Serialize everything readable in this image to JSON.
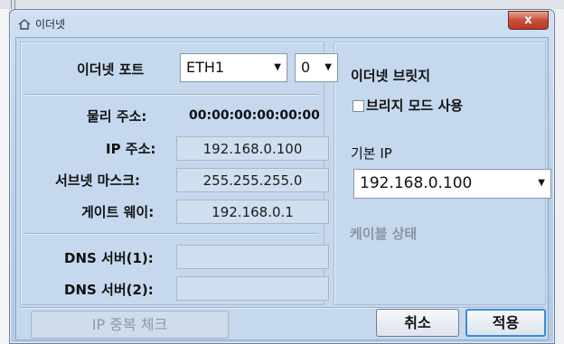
{
  "window": {
    "title": "이더넷",
    "close_label": "x"
  },
  "ethernet_port": {
    "label": "이더넷 포트",
    "port_value": "ETH1",
    "index_value": "0"
  },
  "physical_address": {
    "label": "물리 주소:",
    "value": "00:00:00:00:00:00"
  },
  "ip_address": {
    "label": "IP 주소:",
    "value": "192.168.0.100"
  },
  "subnet_mask": {
    "label": "서브넷 마스크:",
    "value": "255.255.255.0"
  },
  "gateway": {
    "label": "게이트 웨이:",
    "value": "192.168.0.1"
  },
  "dns1": {
    "label": "DNS 서버(1):",
    "value": ""
  },
  "dns2": {
    "label": "DNS 서버(2):",
    "value": ""
  },
  "bridge": {
    "title": "이더넷 브릿지",
    "checkbox_label": "브리지 모드 사용",
    "checked": false
  },
  "default_ip": {
    "label": "기본 IP",
    "value": "192.168.0.100"
  },
  "cable_status": {
    "label": "케이블 상태"
  },
  "buttons": {
    "ip_check": "IP 중복 체크",
    "cancel": "취소",
    "apply": "적용"
  }
}
